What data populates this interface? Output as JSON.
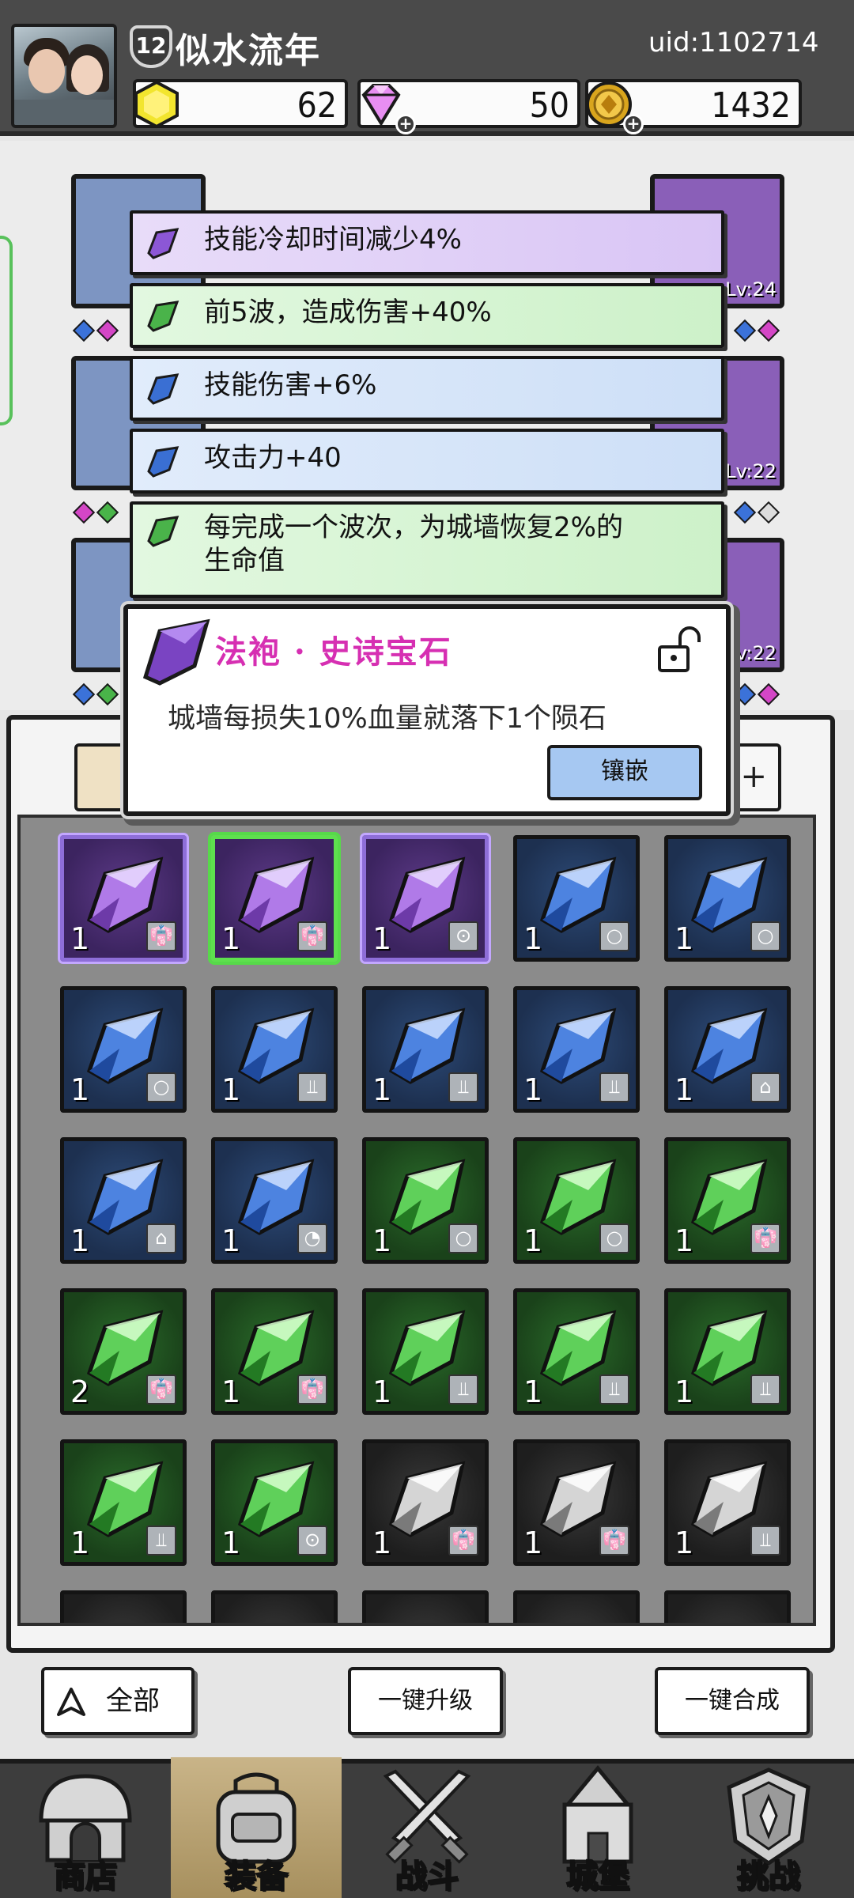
{
  "player": {
    "level": "12",
    "name": "似水流年",
    "uid": "uid:1102714"
  },
  "currency": {
    "gold": "62",
    "gems": "50",
    "coins": "1432"
  },
  "perks": [
    {
      "text": "技能冷却时间减少4%",
      "rarity": "purple"
    },
    {
      "text": "前5波，造成伤害+40%",
      "rarity": "green"
    },
    {
      "text": "技能伤害+6%",
      "rarity": "blue"
    },
    {
      "text": "攻击力+40",
      "rarity": "blue"
    },
    {
      "text": "每完成一个波次，为城墙恢复2%的生命值",
      "line1": "每完成一个波次，为城墙恢复2%的",
      "line2": "生命值",
      "rarity": "green"
    }
  ],
  "popup": {
    "title": "法袍 · 史诗宝石",
    "description": "城墙每损失10%血量就落下1个陨石",
    "inlay_label": "镶嵌"
  },
  "equipment_levels": {
    "right_1": "Lv:24",
    "right_2": "Lv:22",
    "right_3": "Lv:22"
  },
  "inventory": [
    {
      "rarity": "purple",
      "count": "1",
      "slot": "robe"
    },
    {
      "rarity": "purple",
      "count": "1",
      "slot": "robe",
      "selected": true
    },
    {
      "rarity": "purple",
      "count": "1",
      "slot": "amulet"
    },
    {
      "rarity": "blue",
      "count": "1",
      "slot": "ring"
    },
    {
      "rarity": "blue",
      "count": "1",
      "slot": "ring"
    },
    {
      "rarity": "blue",
      "count": "1",
      "slot": "ring"
    },
    {
      "rarity": "blue",
      "count": "1",
      "slot": "boots"
    },
    {
      "rarity": "blue",
      "count": "1",
      "slot": "boots"
    },
    {
      "rarity": "blue",
      "count": "1",
      "slot": "boots"
    },
    {
      "rarity": "blue",
      "count": "1",
      "slot": "staff"
    },
    {
      "rarity": "blue",
      "count": "1",
      "slot": "staff"
    },
    {
      "rarity": "blue",
      "count": "1",
      "slot": "hat"
    },
    {
      "rarity": "green",
      "count": "1",
      "slot": "ring"
    },
    {
      "rarity": "green",
      "count": "1",
      "slot": "ring"
    },
    {
      "rarity": "green",
      "count": "1",
      "slot": "robe"
    },
    {
      "rarity": "green",
      "count": "2",
      "slot": "robe"
    },
    {
      "rarity": "green",
      "count": "1",
      "slot": "robe"
    },
    {
      "rarity": "green",
      "count": "1",
      "slot": "boots"
    },
    {
      "rarity": "green",
      "count": "1",
      "slot": "boots"
    },
    {
      "rarity": "green",
      "count": "1",
      "slot": "boots"
    },
    {
      "rarity": "green",
      "count": "1",
      "slot": "boots"
    },
    {
      "rarity": "green",
      "count": "1",
      "slot": "amulet"
    },
    {
      "rarity": "gray",
      "count": "1",
      "slot": "robe"
    },
    {
      "rarity": "gray",
      "count": "1",
      "slot": "robe"
    },
    {
      "rarity": "gray",
      "count": "1",
      "slot": "boots"
    }
  ],
  "buttons": {
    "filter_label": "全部",
    "upgrade_all": "一键升级",
    "merge_all": "一键合成"
  },
  "nav": [
    {
      "label": "商店",
      "icon": "shop-icon"
    },
    {
      "label": "装备",
      "icon": "backpack-icon",
      "active": true
    },
    {
      "label": "战斗",
      "icon": "swords-icon"
    },
    {
      "label": "城堡",
      "icon": "castle-icon"
    },
    {
      "label": "挑战",
      "icon": "challenge-icon"
    }
  ],
  "colors": {
    "purple": "#8e6ed8",
    "blue": "#2d4b78",
    "green": "#2a6b2a",
    "popup_title": "#d62fb2",
    "inlay_button": "#a6c8f2"
  }
}
